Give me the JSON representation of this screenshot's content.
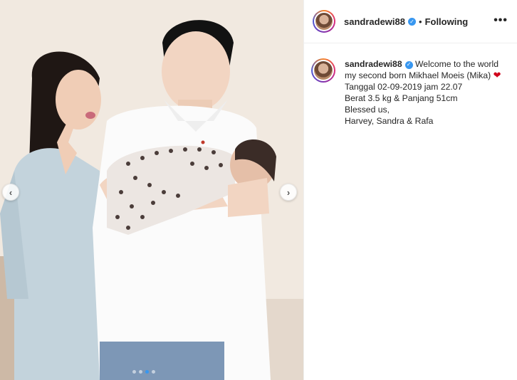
{
  "post": {
    "username": "sandradewi88",
    "following_label": "Following",
    "separator": "•",
    "more_label": "•••",
    "verified_mark": "✓"
  },
  "caption": {
    "username": "sandradewi88",
    "first_text": " Welcome to the world my second born Mikhael Moeis (Mika) ",
    "heart": "❤",
    "lines": [
      "Tanggal 02-09-2019 jam 22.07",
      "Berat 3.5 kg & Panjang 51cm",
      "Blessed us,",
      "Harvey, Sandra & Rafa"
    ]
  },
  "carousel": {
    "prev_label": "‹",
    "next_label": "›",
    "slide_count": 4,
    "active_index": 2
  },
  "colors": {
    "verified": "#3897f0",
    "heart": "#d0021b",
    "active_dot": "#3897f0"
  }
}
